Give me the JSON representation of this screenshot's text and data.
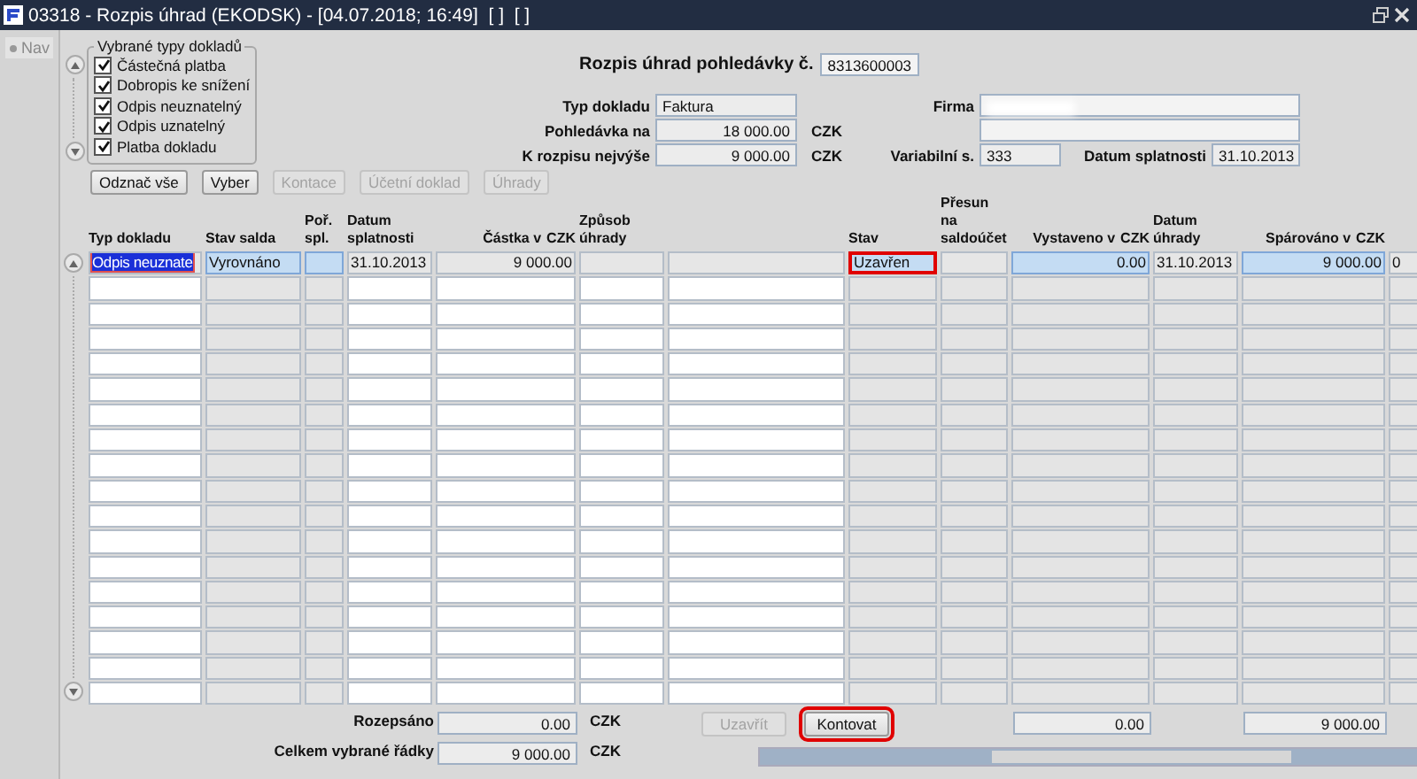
{
  "window": {
    "title": "03318 - Rozpis úhrad (EKODSK) - [04.07.2018; 16:49]  [ ]  [ ]"
  },
  "nav": {
    "label": "Nav"
  },
  "document_types": {
    "legend": "Vybrané typy dokladů",
    "items": [
      {
        "label": "Částečná platba",
        "checked": true
      },
      {
        "label": "Dobropis ke snížení",
        "checked": true
      },
      {
        "label": "Odpis neuznatelný",
        "checked": true
      },
      {
        "label": "Odpis uznatelný",
        "checked": true
      },
      {
        "label": "Platba dokladu",
        "checked": true
      }
    ]
  },
  "top_buttons": [
    {
      "label": "Odznač vše",
      "disabled": false
    },
    {
      "label": "Vyber",
      "disabled": false
    },
    {
      "label": "Kontace",
      "disabled": true
    },
    {
      "label": "Účetní doklad",
      "disabled": true
    },
    {
      "label": "Úhrady",
      "disabled": true
    }
  ],
  "header": {
    "title": "Rozpis úhrad pohledávky č.",
    "number": "8313600003"
  },
  "form": {
    "typ_dokladu": {
      "label": "Typ dokladu",
      "value": "Faktura"
    },
    "pohledavka": {
      "label": "Pohledávka na",
      "value": "18 000.00",
      "unit": "CZK"
    },
    "k_rozpisu": {
      "label": "K rozpisu nejvýše",
      "value": "9 000.00",
      "unit": "CZK"
    },
    "firma": {
      "label": "Firma"
    },
    "variabilni": {
      "label": "Variabilní s.",
      "value": "333"
    },
    "datum_splatnosti": {
      "label": "Datum splatnosti",
      "value": "31.10.2013"
    }
  },
  "table": {
    "columns": [
      {
        "label": "Typ dokladu",
        "kind": "editable"
      },
      {
        "label": "Stav salda",
        "kind": "readonly"
      },
      {
        "label": "Poř. spl.",
        "kind": "readonly"
      },
      {
        "label": "Datum splatnosti",
        "kind": "editable"
      },
      {
        "label": "Částka v",
        "unit": "CZK",
        "kind": "editable"
      },
      {
        "label": "Způsob úhrady",
        "kind": "editable"
      },
      {
        "kind": "editable"
      },
      {
        "label": "Stav",
        "kind": "readonly"
      },
      {
        "label": "Přesun na saldoúčet",
        "kind": "readonly"
      },
      {
        "label": "Vystaveno v",
        "unit": "CZK",
        "kind": "readonly"
      },
      {
        "label": "Datum úhrady",
        "kind": "readonly"
      },
      {
        "label": "Spárováno v",
        "unit": "CZK",
        "kind": "readonly"
      },
      {
        "kind": "readonly"
      }
    ],
    "rows": [
      {
        "cells": [
          {
            "text": "Odpis neuznate",
            "selected": false,
            "focused": true,
            "flagged": false
          },
          {
            "text": "Vyrovnáno",
            "selected": true,
            "focused": false,
            "flagged": false
          },
          {
            "selected": true,
            "focused": false,
            "flagged": false
          },
          {
            "text": "31.10.2013",
            "selected": false,
            "focused": false,
            "flagged": false
          },
          {
            "text": "9 000.00",
            "selected": false,
            "focused": false,
            "flagged": false
          },
          {
            "selected": false,
            "focused": false,
            "flagged": false
          },
          {
            "selected": false,
            "focused": false,
            "flagged": false
          },
          {
            "text": "Uzavřen",
            "selected": true,
            "focused": false,
            "flagged": true
          },
          {
            "selected": false,
            "focused": false,
            "flagged": false
          },
          {
            "text": "0.00",
            "selected": true,
            "focused": false,
            "flagged": false
          },
          {
            "text": "31.10.2013",
            "selected": false,
            "focused": false,
            "flagged": false
          },
          {
            "text": "9 000.00",
            "selected": true,
            "focused": false,
            "flagged": false
          },
          {
            "text": "0",
            "selected": false,
            "focused": false,
            "flagged": false
          }
        ]
      }
    ]
  },
  "totals": [
    {
      "label": "Rozepsáno",
      "value": "0.00",
      "unit": "CZK"
    },
    {
      "label": "Celkem vybrané řádky",
      "value": "9 000.00",
      "unit": "CZK"
    }
  ],
  "bottom_buttons": [
    {
      "label": "Uzavřít",
      "disabled": true,
      "flagged": false
    },
    {
      "label": "Kontovat",
      "disabled": false,
      "flagged": true
    }
  ],
  "column_totals": [
    {
      "value": "0.00"
    },
    {
      "value": "9 000.00"
    }
  ]
}
